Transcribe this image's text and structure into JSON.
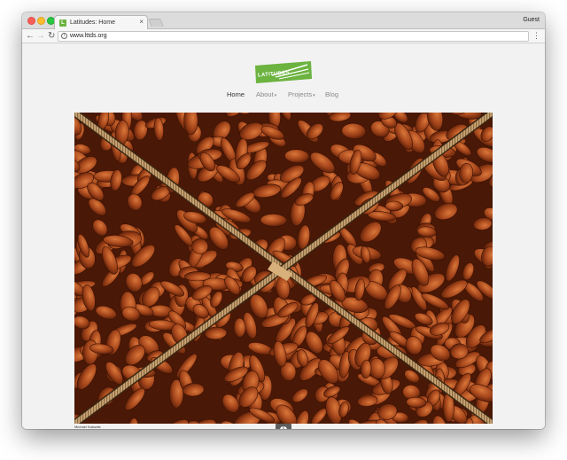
{
  "browser": {
    "tab_title": "Latitudes: Home",
    "tab_favicon_letter": "L",
    "tab_close": "×",
    "profile_label": "Guest",
    "address": "www.lttds.org",
    "back_glyph": "←",
    "forward_glyph": "→",
    "reload_glyph": "↻",
    "menu_glyph": "⋮",
    "info_glyph": "i"
  },
  "site": {
    "logo_text": "LATITUDES",
    "brand_color": "#6cb33f",
    "nav": [
      {
        "label": "Home",
        "active": true
      },
      {
        "label": "About",
        "caret": "▾"
      },
      {
        "label": "Projects",
        "caret": "▾"
      },
      {
        "label": "Blog"
      }
    ],
    "hero_alt": "Dried dates in a cardboard box",
    "photo_credit": "Michael Kalowitz",
    "info_button_glyph": "i"
  },
  "icons": {
    "close": "close-icon",
    "back": "back-arrow-icon",
    "forward": "forward-arrow-icon",
    "reload": "reload-icon",
    "site_info": "info-icon",
    "menu": "kebab-menu-icon",
    "caret": "chevron-down-icon"
  }
}
